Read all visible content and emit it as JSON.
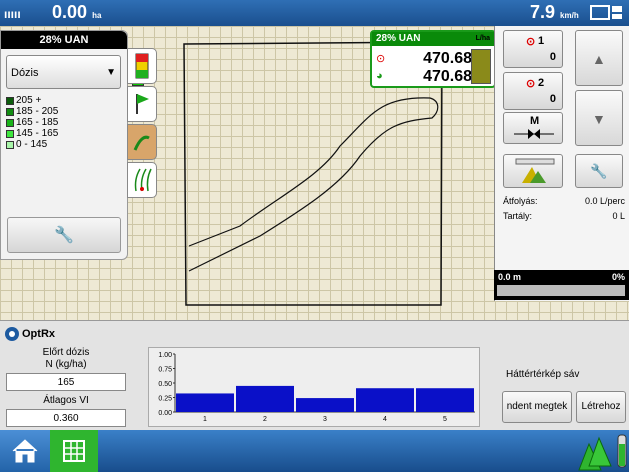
{
  "topbar": {
    "area_value": "0.00",
    "area_unit": "ha",
    "speed_value": "7.9",
    "speed_unit": "km/h"
  },
  "left_panel": {
    "title": "28% UAN",
    "select_value": "Dózis",
    "legend": [
      {
        "label": "205 +",
        "color": "#0b5c0b"
      },
      {
        "label": "185 - 205",
        "color": "#128c12"
      },
      {
        "label": "165 - 185",
        "color": "#19b319"
      },
      {
        "label": "145 - 165",
        "color": "#3ee63e"
      },
      {
        "label": "0 - 145",
        "color": "#a9f5a9"
      }
    ]
  },
  "rate_box": {
    "product": "28% UAN",
    "unit": "L/ha",
    "target": "470.68",
    "actual": "470.68"
  },
  "right_panel": {
    "section1": {
      "label": "1",
      "value": "0"
    },
    "section2": {
      "label": "2",
      "value": "0"
    },
    "m_label": "M",
    "flow_label": "Átfolyás:",
    "flow_value": "0.0 L/perc",
    "tank_label": "Tartály:",
    "tank_value": "0 L",
    "distance": "0.0 m",
    "percent": "0%"
  },
  "bottom_panel": {
    "title": "OptRx",
    "pred_label_1": "Előrt dózis",
    "pred_label_2": "N (kg/ha)",
    "pred_value": "165",
    "avg_label": "Átlagos VI",
    "avg_value": "0.360",
    "bg_label": "Háttértérkép sáv",
    "btn1": "ndent megtek",
    "btn2": "Létrehoz"
  },
  "chart_data": {
    "type": "bar",
    "categories": [
      "1",
      "2",
      "3",
      "4",
      "5"
    ],
    "values": [
      0.32,
      0.45,
      0.24,
      0.41,
      0.41
    ],
    "yticks": [
      "1.00",
      "0.75",
      "0.50",
      "0.25",
      "0.00"
    ],
    "ylim": [
      0,
      1
    ]
  }
}
